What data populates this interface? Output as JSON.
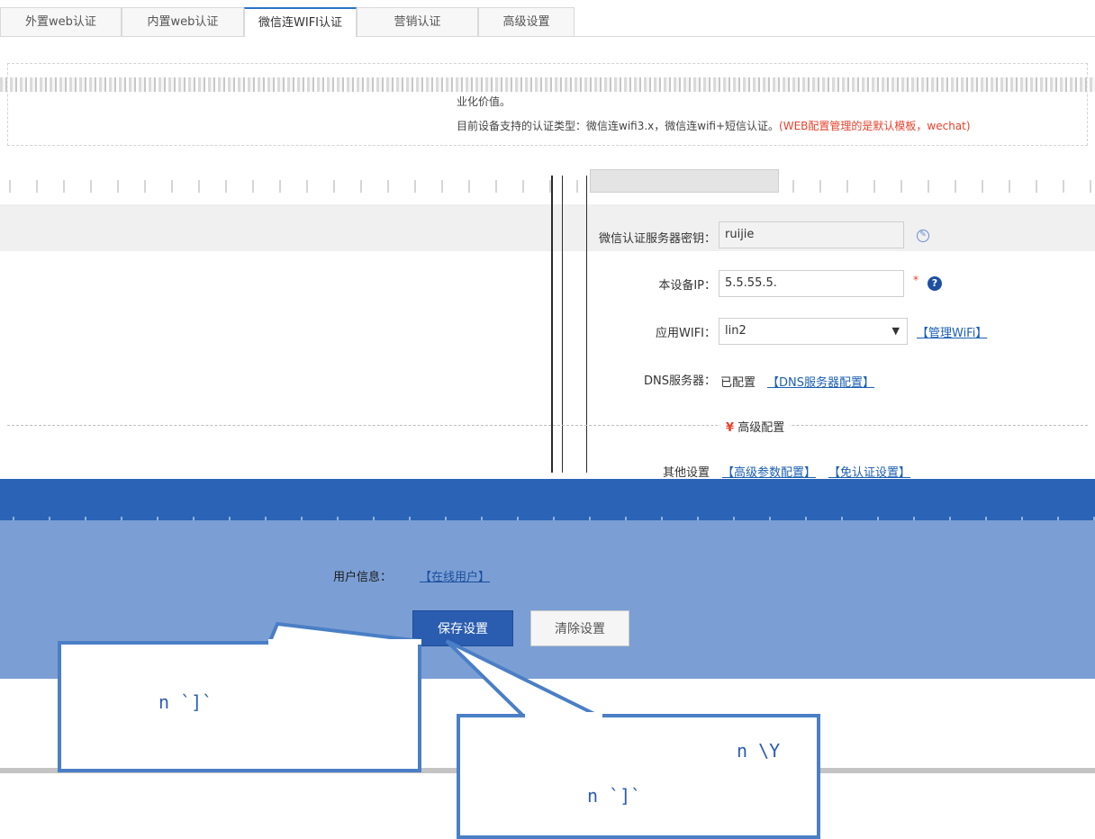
{
  "tabs": [
    {
      "label": "外置web认证"
    },
    {
      "label": "内置web认证"
    },
    {
      "label": "微信连WIFI认证"
    },
    {
      "label": "营销认证"
    },
    {
      "label": "高级设置"
    }
  ],
  "info": {
    "line2": "业化价值。",
    "line3_prefix": "目前设备支持的认证类型：微信连wifi3.x，微信连wifi+短信认证。",
    "line3_red": "(WEB配置管理的是默认模板，wechat)"
  },
  "form": {
    "server_key_label": "微信认证服务器密钥：",
    "server_key_value": "ruijie",
    "device_ip_label": "本设备IP：",
    "device_ip_value": "5.5.55.5.",
    "device_ip_required": "*",
    "help_icon": "?",
    "wifi_label": "应用WIFI：",
    "wifi_value": "lin2",
    "wifi_manage_link": "【管理WiFi】",
    "dns_label": "DNS服务器：",
    "dns_value": "已配置",
    "dns_link": "【DNS服务器配置】",
    "advanced_toggle": "高级配置",
    "other_label": "其他设置",
    "other_links": [
      "【高级参数配置】",
      "【免认证设置】"
    ]
  },
  "bottom": {
    "user_info_label": "用户信息：",
    "user_info_link": "【在线用户】",
    "save_button": "保存设置",
    "clear_button": "清除设置"
  },
  "callouts": {
    "left_text": "n `]`",
    "right_line1": "n \\Y",
    "right_line2": "n `]`"
  },
  "colors": {
    "accent": "#2a5db0",
    "band_dark": "#2b64b6",
    "band_light": "#7b9fd4",
    "red": "#e8412c",
    "link": "#1b5fb2"
  }
}
